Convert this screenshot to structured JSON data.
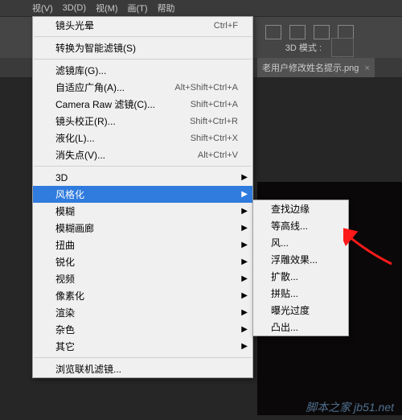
{
  "top_bar": {
    "m1": "视(V)",
    "m2": "3D(D)",
    "m3": "视(M)",
    "m4": "画(T)",
    "m5": "帮助"
  },
  "toolbar": {
    "mode_label": "3D 模式 :"
  },
  "tab": {
    "filename": "老用户修改姓名提示.png",
    "close": "×"
  },
  "menu": {
    "items": [
      {
        "label": "镜头光晕",
        "shortcut": "Ctrl+F"
      },
      {
        "label": "转换为智能滤镜(S)"
      },
      {
        "label": "滤镜库(G)..."
      },
      {
        "label": "自适应广角(A)...",
        "shortcut": "Alt+Shift+Ctrl+A"
      },
      {
        "label": "Camera Raw 滤镜(C)...",
        "shortcut": "Shift+Ctrl+A"
      },
      {
        "label": "镜头校正(R)...",
        "shortcut": "Shift+Ctrl+R"
      },
      {
        "label": "液化(L)...",
        "shortcut": "Shift+Ctrl+X"
      },
      {
        "label": "消失点(V)...",
        "shortcut": "Alt+Ctrl+V"
      },
      {
        "label": "3D",
        "arrow": "▶"
      },
      {
        "label": "风格化",
        "arrow": "▶"
      },
      {
        "label": "模糊",
        "arrow": "▶"
      },
      {
        "label": "模糊画廊",
        "arrow": "▶"
      },
      {
        "label": "扭曲",
        "arrow": "▶"
      },
      {
        "label": "锐化",
        "arrow": "▶"
      },
      {
        "label": "视频",
        "arrow": "▶"
      },
      {
        "label": "像素化",
        "arrow": "▶"
      },
      {
        "label": "渲染",
        "arrow": "▶"
      },
      {
        "label": "杂色",
        "arrow": "▶"
      },
      {
        "label": "其它",
        "arrow": "▶"
      },
      {
        "label": "浏览联机滤镜..."
      }
    ]
  },
  "submenu": {
    "items": [
      "查找边缘",
      "等高线...",
      "风...",
      "浮雕效果...",
      "扩散...",
      "拼贴...",
      "曝光过度",
      "凸出..."
    ]
  },
  "watermark": "脚本之家 jb51.net"
}
